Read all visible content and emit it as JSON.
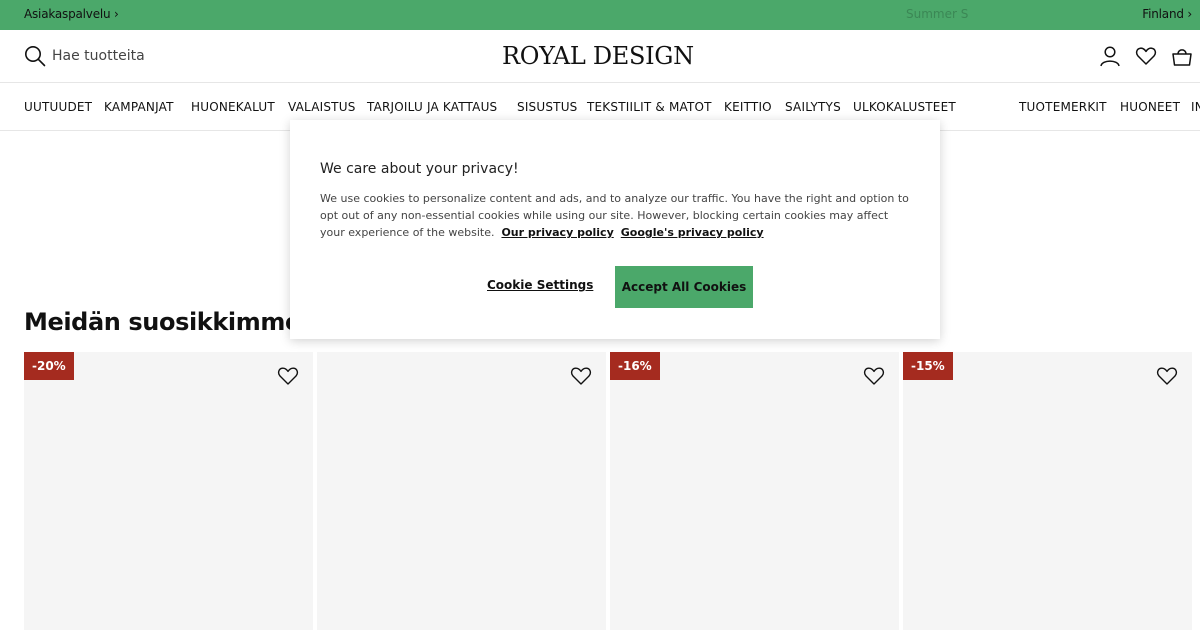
{
  "topbar": {
    "customer_service": "Asiakaspalvelu ›",
    "promo": "Summer S",
    "country": "Finland ›"
  },
  "header": {
    "search_placeholder": "Hae tuotteita",
    "logo": "ROYAL DESIGN",
    "icons": [
      "user-icon",
      "heart-icon",
      "bag-icon"
    ]
  },
  "nav": {
    "items": [
      "UUTUUDET",
      "KAMPANJAT",
      "HUONEKALUT",
      "VALAISTUS",
      "TARJOILU JA KATTAUS",
      "SISUSTUS",
      "TEKSTIILIT & MATOT",
      "KEITTIO",
      "SAILYTYS",
      "ULKOKALUSTEET"
    ],
    "right_items": [
      "TUOTEMERKIT",
      "HUONEET",
      "IN"
    ]
  },
  "main": {
    "section_title": "Meidän suosikkimme",
    "products": [
      {
        "badge": "-20%"
      },
      {
        "badge": ""
      },
      {
        "badge": "-16%"
      },
      {
        "badge": "-15%"
      }
    ]
  },
  "cookie": {
    "title": "We care about your privacy!",
    "body": "We use cookies to personalize content and ads, and to analyze our traffic. You have the right and option to opt out of any non-essential cookies while using our site. However, blocking certain cookies may affect your experience of the website.",
    "privacy_link": "Our privacy policy",
    "google_link": "Google's privacy policy",
    "settings_label": "Cookie Settings",
    "accept_label": "Accept All Cookies"
  },
  "colors": {
    "accent_green": "#4ba86a",
    "badge_red": "#a52b1f",
    "card_bg": "#f5f5f5"
  }
}
